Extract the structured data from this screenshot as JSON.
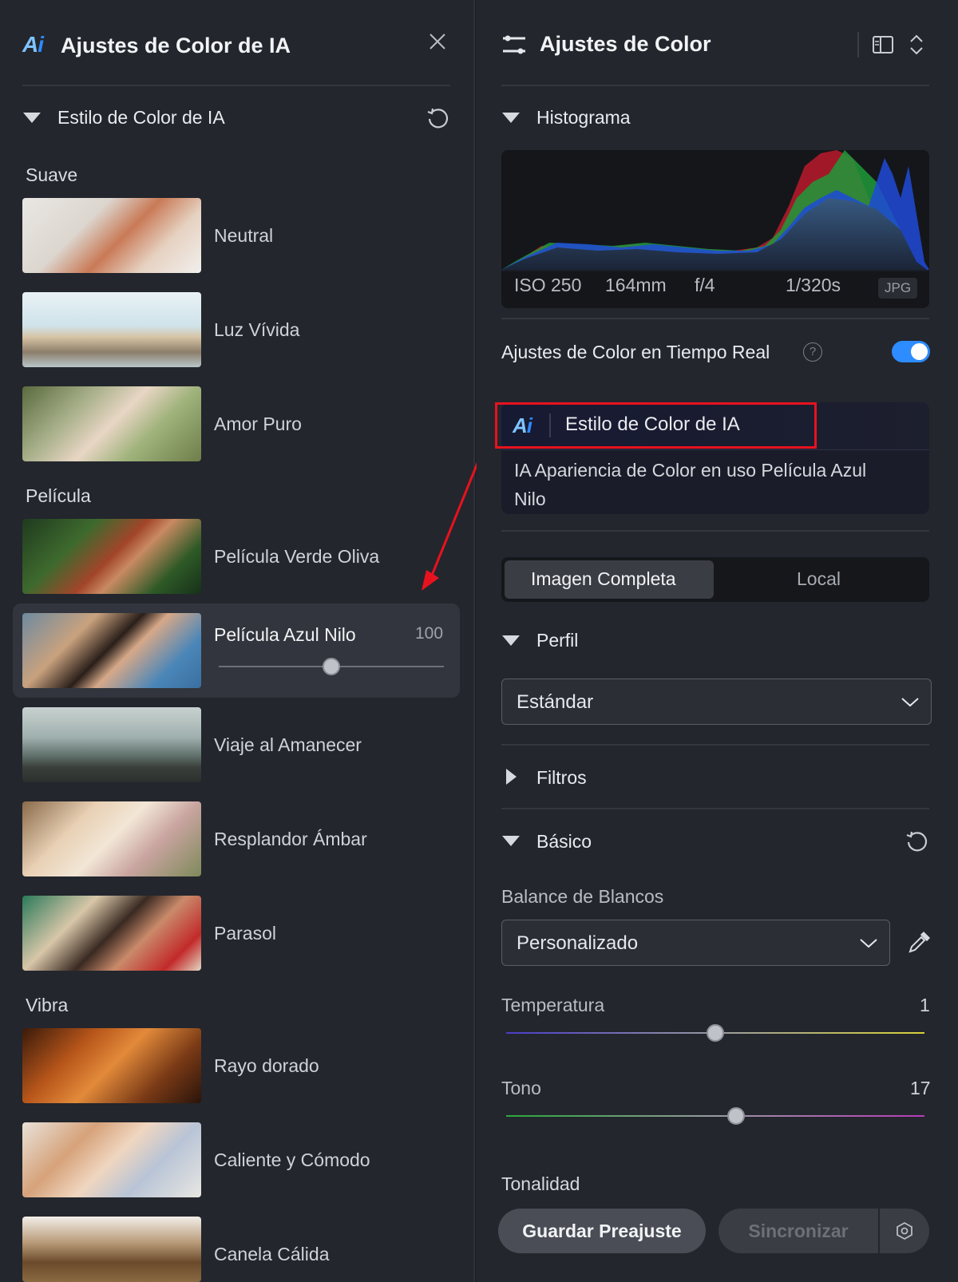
{
  "left_panel": {
    "title": "Ajustes de Color de IA",
    "section_title": "Estilo de Color de IA",
    "groups": [
      {
        "label": "Suave",
        "presets": [
          "Neutral",
          "Luz Vívida",
          "Amor Puro"
        ]
      },
      {
        "label": "Película",
        "presets": [
          "Película Verde Oliva",
          "Película Azul Nilo",
          "Viaje al Amanecer",
          "Resplandor Ámbar",
          "Parasol"
        ]
      },
      {
        "label": "Vibra",
        "presets": [
          "Rayo dorado",
          "Caliente y Cómodo",
          "Canela Cálida"
        ]
      }
    ],
    "selected_preset": {
      "name": "Película Azul Nilo",
      "intensity": "100",
      "intensity_fraction": 0.5
    }
  },
  "right_panel": {
    "title": "Ajustes de Color",
    "histogram": {
      "title": "Histograma",
      "iso": "ISO 250",
      "focal": "164mm",
      "aperture": "f/4",
      "shutter": "1/320s",
      "format": "JPG"
    },
    "realtime": {
      "label": "Ajustes de Color en Tiempo Real",
      "help": "?",
      "enabled": true
    },
    "ai_style": {
      "title": "Estilo de Color de IA",
      "desc_line1": "IA Apariencia de Color en uso Película Azul",
      "desc_line2": "Nilo"
    },
    "tabs": {
      "full": "Imagen Completa",
      "local": "Local"
    },
    "profile": {
      "title": "Perfil",
      "value": "Estándar"
    },
    "filters": {
      "title": "Filtros"
    },
    "basic": {
      "title": "Básico",
      "wb_label": "Balance de Blancos",
      "wb_value": "Personalizado",
      "temperature": {
        "label": "Temperatura",
        "value": "1",
        "fraction": 0.5
      },
      "tint": {
        "label": "Tono",
        "value": "17",
        "fraction": 0.55
      },
      "tone_label": "Tonalidad"
    },
    "buttons": {
      "save": "Guardar Preajuste",
      "sync": "Sincronizar"
    }
  },
  "colors": {
    "accent": "#2d8cff",
    "highlight": "#e8121e",
    "panel": "#23262d"
  }
}
